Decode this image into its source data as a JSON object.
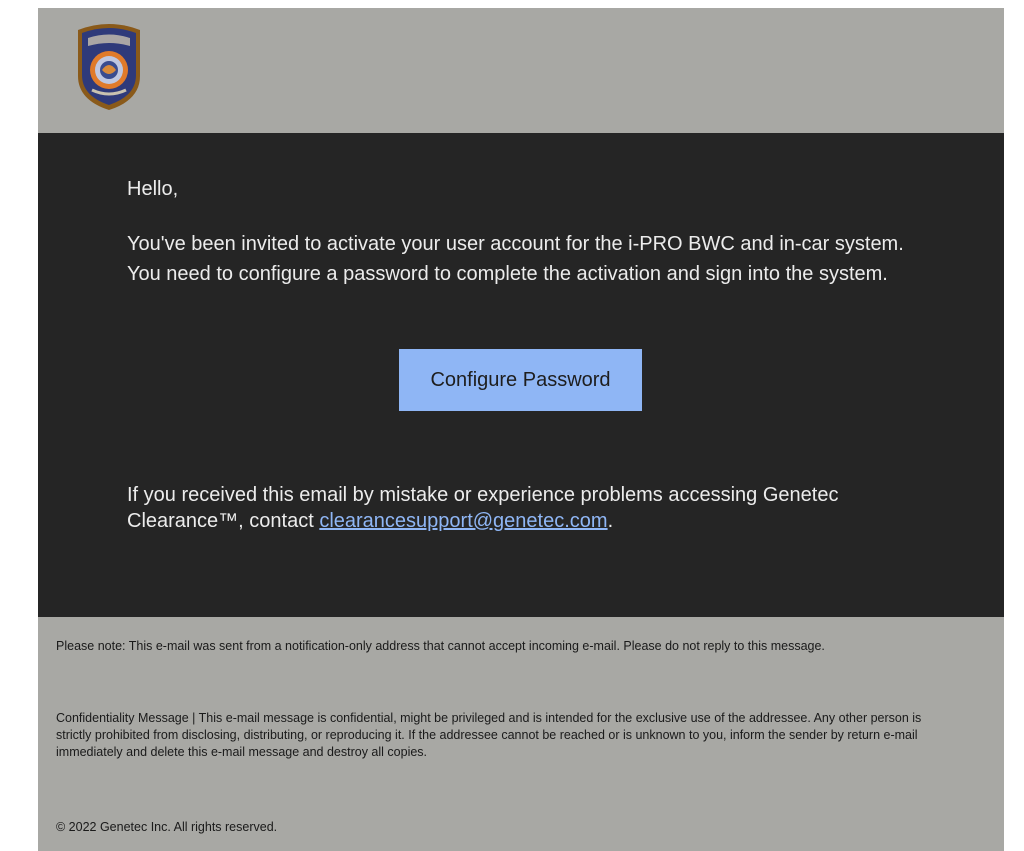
{
  "header": {
    "logo_icon": "police-department-patch-icon",
    "logo_colors": {
      "shield": "#2f3a7a",
      "border": "#8a5a1a",
      "seal": "#e07a2a"
    }
  },
  "card": {
    "greeting": "Hello,",
    "message": "You've been invited to activate your user account for the i-PRO BWC and in-car system. You need to configure a password to complete the activation and sign into the system.",
    "cta_label": "Configure Password",
    "help_text_prefix": "If you received this email by mistake or experience problems accessing Genetec Clearance™, contact",
    "support_email": "clearancesupport@genetec.com",
    "help_text_suffix": "."
  },
  "notes": {
    "note_1": "Please note: This e-mail was sent from a notification-only address that cannot accept incoming e-mail. Please do not reply to this message.",
    "confidentiality": "Confidentiality Message | This e-mail message is confidential, might be privileged and is intended for the exclusive use of the addressee. Any other person is strictly prohibited from disclosing, distributing, or reproducing it. If the addressee cannot be reached or is unknown to you, inform the sender by return e-mail immediately and delete this e-mail message and destroy all copies.",
    "copyright": "© 2022 Genetec Inc. All rights reserved."
  },
  "colors": {
    "page_bg": "#a8a8a4",
    "card_bg": "#252525",
    "button_bg": "#8fb6f5",
    "link": "#8fb6f5"
  }
}
